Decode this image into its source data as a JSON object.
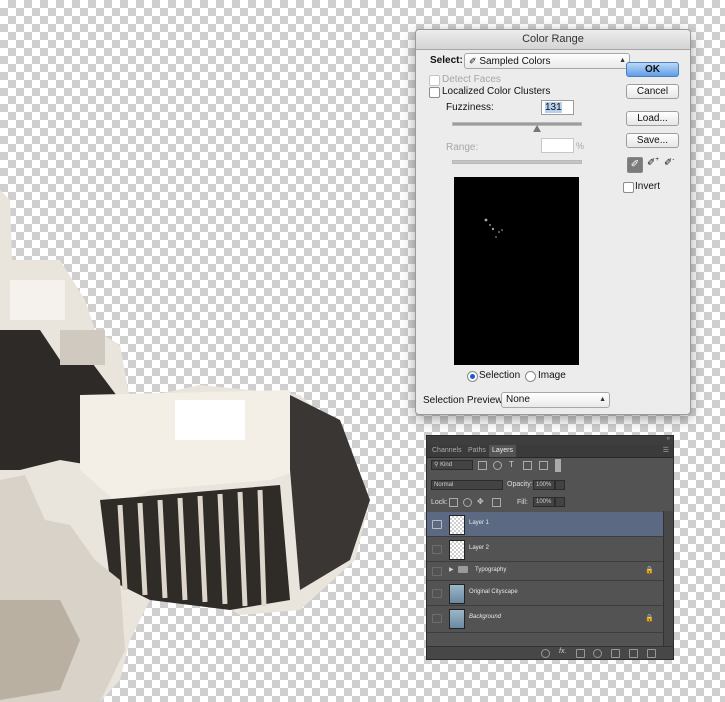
{
  "dialog": {
    "title": "Color Range",
    "select_label": "Select:",
    "select_value": "Sampled Colors",
    "detect_faces": "Detect Faces",
    "localized_clusters": "Localized Color Clusters",
    "fuzziness_label": "Fuzziness:",
    "fuzziness_value": "131",
    "range_label": "Range:",
    "range_value": "",
    "range_unit": "%",
    "invert_label": "Invert",
    "radio_selection": "Selection",
    "radio_image": "Image",
    "preview_label": "Selection Preview:",
    "preview_value": "None",
    "buttons": {
      "ok": "OK",
      "cancel": "Cancel",
      "load": "Load...",
      "save": "Save..."
    }
  },
  "layers_panel": {
    "tabs": [
      "Channels",
      "Paths",
      "Layers"
    ],
    "active_tab": "Layers",
    "filter_kind": "Kind",
    "blend_mode": "Normal",
    "opacity_label": "Opacity:",
    "opacity_value": "100%",
    "lock_label": "Lock:",
    "fill_label": "Fill:",
    "fill_value": "100%",
    "layers": [
      {
        "name": "Layer 1",
        "selected": true,
        "visible": true
      },
      {
        "name": "Layer 2",
        "selected": false,
        "visible": false
      },
      {
        "name": "Typography",
        "selected": false,
        "visible": false,
        "group": true,
        "locked": true
      },
      {
        "name": "Original Cityscape",
        "selected": false,
        "visible": false
      },
      {
        "name": "Background",
        "selected": false,
        "visible": false,
        "locked": true
      }
    ]
  },
  "colors": {
    "accent": "#5e9ee8",
    "selected_row": "#5b6a82",
    "panel_bg": "#535353"
  }
}
